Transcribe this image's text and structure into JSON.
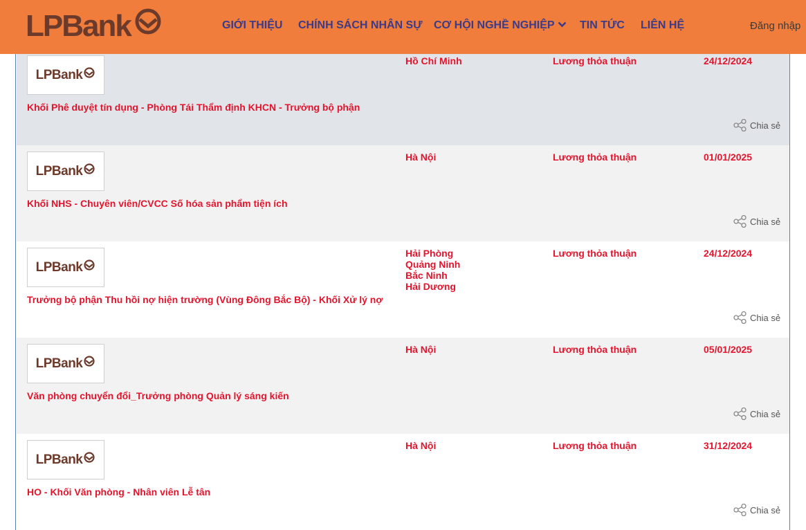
{
  "header": {
    "logo_text": "LPBank",
    "nav": [
      {
        "label": "GIỚI THIỆU"
      },
      {
        "label": "CHÍNH SÁCH NHÂN SỰ"
      },
      {
        "label": "CƠ HỘI NGHỀ NGHIỆP"
      },
      {
        "label": "TIN TỨC"
      },
      {
        "label": "LIÊN HỆ"
      }
    ],
    "login_label": "Đăng nhập"
  },
  "jobs": [
    {
      "logo_text": "LPBank",
      "title": "Khối Phê duyệt tín dụng - Phòng Tái Thẩm định KHCN - Trưởng bộ phận",
      "locations": [
        "Hồ Chí Minh"
      ],
      "salary": "Lương thỏa thuận",
      "date": "24/12/2024",
      "share_label": "Chia sẻ"
    },
    {
      "logo_text": "LPBank",
      "title": "Khối NHS - Chuyên viên/CVCC Số hóa sản phẩm tiện ích",
      "locations": [
        "Hà Nội"
      ],
      "salary": "Lương thỏa thuận",
      "date": "01/01/2025",
      "share_label": "Chia sẻ"
    },
    {
      "logo_text": "LPBank",
      "title": "Trưởng bộ phận Thu hồi nợ hiện trường (Vùng Đông Bắc Bộ) - Khối Xử lý nợ",
      "locations": [
        "Hải Phòng",
        "Quảng Ninh",
        "Bắc Ninh",
        "Hải Dương"
      ],
      "salary": "Lương thỏa thuận",
      "date": "24/12/2024",
      "share_label": "Chia sẻ"
    },
    {
      "logo_text": "LPBank",
      "title": "Văn phòng chuyển đổi_Trưởng phòng Quản lý sáng kiến",
      "locations": [
        "Hà Nội"
      ],
      "salary": "Lương thỏa thuận",
      "date": "05/01/2025",
      "share_label": "Chia sẻ"
    },
    {
      "logo_text": "LPBank",
      "title": "HO - Khối Văn phòng - Nhân viên Lễ tân",
      "locations": [
        "Hà Nội"
      ],
      "salary": "Lương thỏa thuận",
      "date": "31/12/2024",
      "share_label": "Chia sẻ"
    }
  ],
  "colors": {
    "header_bg": "#f07d3c",
    "nav_text": "#3b3b8a",
    "job_text": "#e3142c",
    "brand_brown": "#6b3a2a"
  }
}
